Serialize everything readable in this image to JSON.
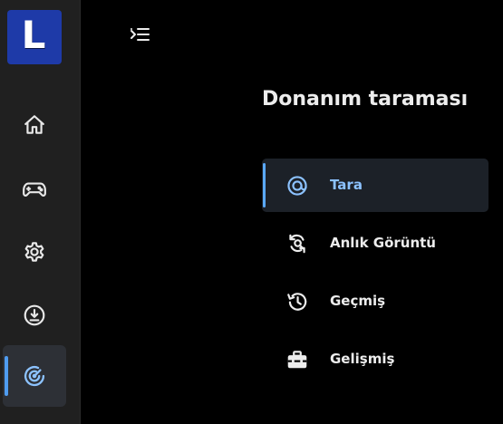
{
  "logo": {
    "letter": "L",
    "color": "#1e3aa8"
  },
  "rail": {
    "items": [
      {
        "name": "home",
        "icon": "home-icon",
        "active": false
      },
      {
        "name": "games",
        "icon": "gamepad-icon",
        "active": false
      },
      {
        "name": "settings",
        "icon": "gear-icon",
        "active": false
      },
      {
        "name": "downloads",
        "icon": "download-icon",
        "active": false
      },
      {
        "name": "hardware-scan",
        "icon": "radar-icon",
        "active": true
      }
    ]
  },
  "header": {
    "menu_toggle_icon": "collapse-menu-icon"
  },
  "main": {
    "title": "Donanım taraması",
    "nav": [
      {
        "label": "Tara",
        "icon": "scan-target-icon",
        "selected": true
      },
      {
        "label": "Anlık Görüntü",
        "icon": "snapshot-refresh-icon",
        "selected": false
      },
      {
        "label": "Geçmiş",
        "icon": "history-icon",
        "selected": false
      },
      {
        "label": "Gelişmiş",
        "icon": "toolbox-icon",
        "selected": false
      }
    ]
  },
  "colors": {
    "accent": "#5aa9ff",
    "selected_text": "#8cc2ff",
    "rail_bg": "#202020",
    "selected_bg": "#1c2128"
  }
}
